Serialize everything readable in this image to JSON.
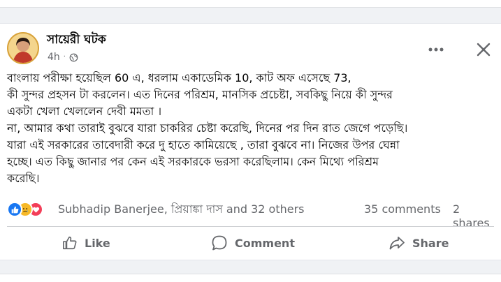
{
  "post": {
    "author": "সায়েরী ঘটক",
    "time": "4h",
    "audience_icon": "globe-icon",
    "text_lines": [
      "বাংলায় পরীক্ষা হয়েছিল 60 এ, ধরলাম একাডেমিক 10, কাট অফ এসেছে 73,",
      "কী সুন্দর প্রহসন টা করলেন। এত দিনের পরিশ্রম, মানসিক প্রচেষ্টা, সবকিছু নিয়ে কী সুন্দর",
      "একটা খেলা খেললেন দেবী মমতা ।",
      "না, আমার কথা তারাই বুঝবে যারা চাকরির চেষ্টা করেছি, দিনের পর দিন রাত জেগে পড়েছি।",
      "যারা এই সরকারের তাবেদারী করে দু হাতে কামিয়েছে , তারা বুঝবে না। নিজের উপর ঘেন্না",
      "হচ্ছে। এত কিছু জানার পর কেন এই সরকারকে ভরসা করেছিলাম। কেন মিথ্যে পরিশ্রম",
      "করেছি।"
    ]
  },
  "stats": {
    "reactors": "Subhadip Banerjee, প্রিয়াঙ্কা দাস and 32 others",
    "comments": "35 comments",
    "shares": "2 shares"
  },
  "actions": {
    "like": "Like",
    "comment": "Comment",
    "share": "Share"
  },
  "colors": {
    "like_blue": "#1877f2",
    "sad_yellow": "#f7b928",
    "love_red": "#f33e58",
    "secondary_text": "#65676b"
  }
}
